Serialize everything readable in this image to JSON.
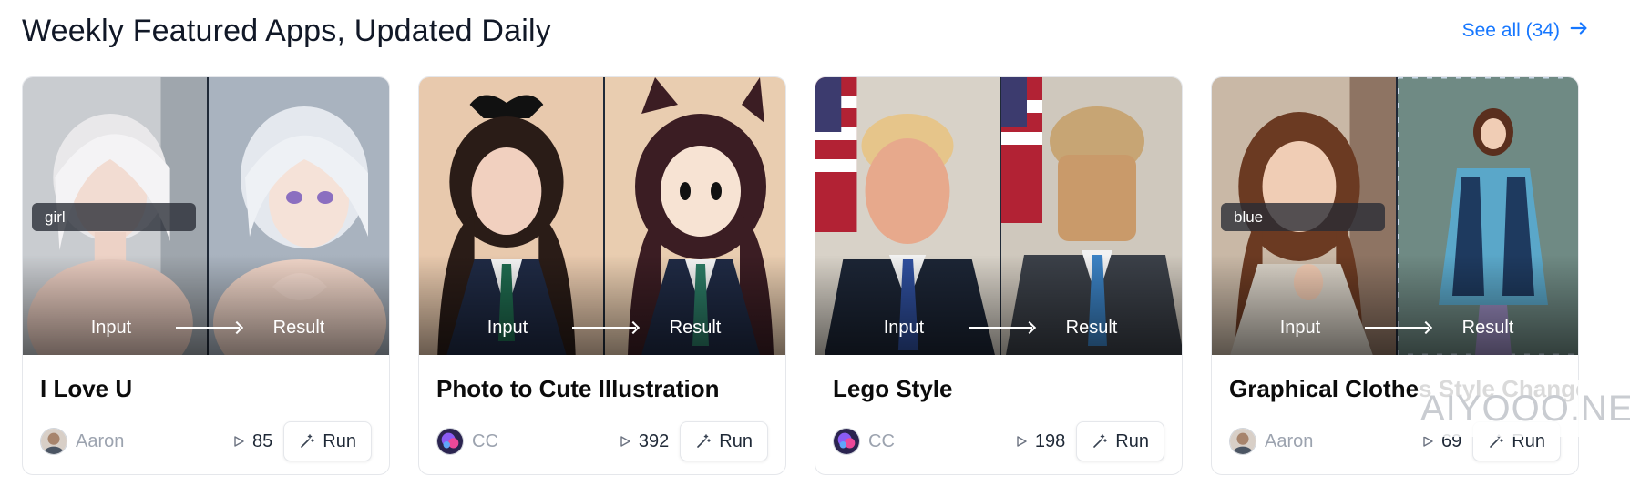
{
  "header": {
    "title": "Weekly Featured Apps, Updated Daily",
    "see_all": "See all (34)",
    "see_all_icon": "arrow-right-icon",
    "accent": "#1677ff"
  },
  "labels": {
    "input": "Input",
    "result": "Result",
    "run": "Run"
  },
  "cards": [
    {
      "name": "I Love U",
      "author": "Aaron",
      "plays": "85",
      "tag": "girl"
    },
    {
      "name": "Photo to Cute Illustration",
      "author": "CC",
      "plays": "392",
      "tag": ""
    },
    {
      "name": "Lego Style",
      "author": "CC",
      "plays": "198",
      "tag": ""
    },
    {
      "name": "Graphical Clothes Style Change",
      "author": "Aaron",
      "plays": "69",
      "tag": "blue"
    }
  ],
  "watermark": "AIYOOO.NET"
}
